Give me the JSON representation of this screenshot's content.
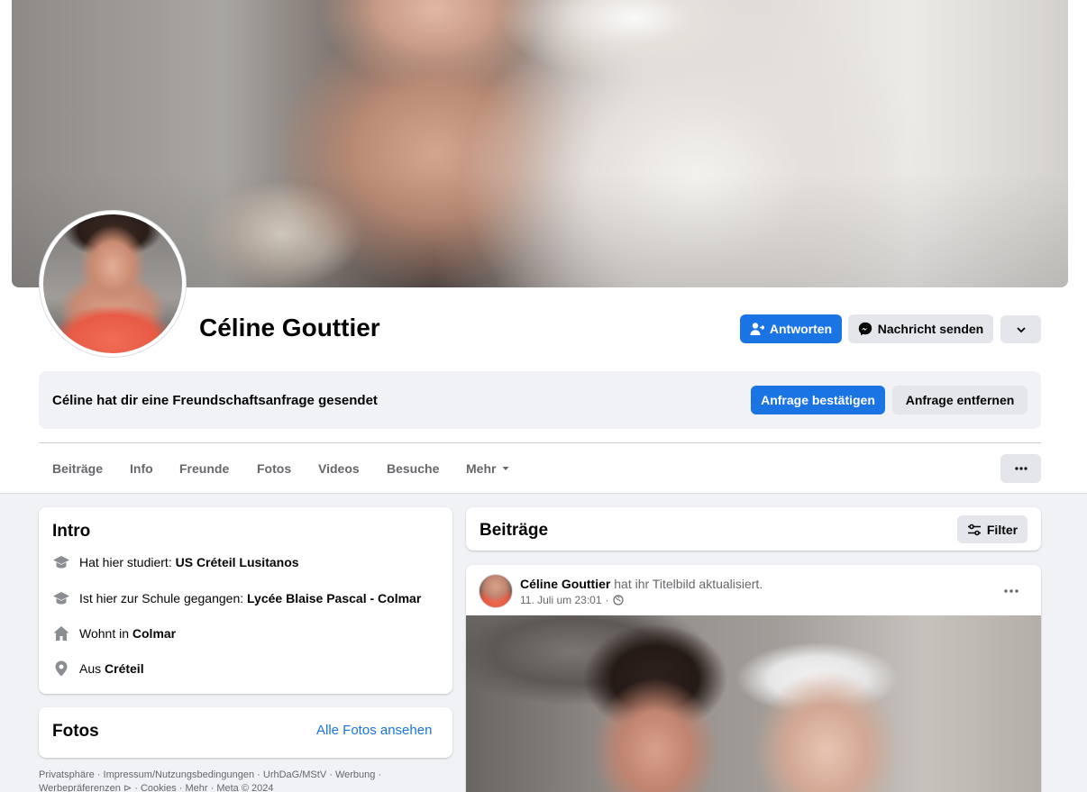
{
  "profile": {
    "name": "Céline Gouttier"
  },
  "actions": {
    "reply_label": "Antworten",
    "message_label": "Nachricht senden"
  },
  "friend_request": {
    "text": "Céline hat dir eine Freundschaftsanfrage gesendet",
    "confirm_label": "Anfrage bestätigen",
    "remove_label": "Anfrage entfernen"
  },
  "nav": {
    "tabs": [
      "Beiträge",
      "Info",
      "Freunde",
      "Fotos",
      "Videos",
      "Besuche",
      "Mehr"
    ]
  },
  "intro": {
    "title": "Intro",
    "items": [
      {
        "icon": "graduation-cap-icon",
        "prefix": "Hat hier studiert: ",
        "value": "US Créteil Lusitanos"
      },
      {
        "icon": "graduation-cap-icon",
        "prefix": "Ist hier zur Schule gegangen: ",
        "value": "Lycée Blaise Pascal - Colmar"
      },
      {
        "icon": "home-icon",
        "prefix": "Wohnt in ",
        "value": "Colmar"
      },
      {
        "icon": "location-pin-icon",
        "prefix": "Aus ",
        "value": "Créteil"
      }
    ]
  },
  "photos": {
    "title": "Fotos",
    "link_label": "Alle Fotos ansehen"
  },
  "footer": {
    "links": [
      "Privatsphäre",
      "Impressum/Nutzungsbedingungen",
      "UrhDaG/MStV",
      "Werbung",
      "Werbepräferenzen",
      "Cookies",
      "Mehr",
      "Meta © 2024"
    ]
  },
  "posts": {
    "title": "Beiträge",
    "filter_label": "Filter",
    "items": [
      {
        "author": "Céline Gouttier",
        "action": "hat ihr Titelbild aktualisiert.",
        "time": "11. Juli um 23:01",
        "visibility_icon": "globe-icon"
      }
    ]
  },
  "colors": {
    "accent": "#1b74e4",
    "secondary_button": "#e4e6eb",
    "page_background": "#f0f2f5",
    "muted_text": "#65676b"
  }
}
